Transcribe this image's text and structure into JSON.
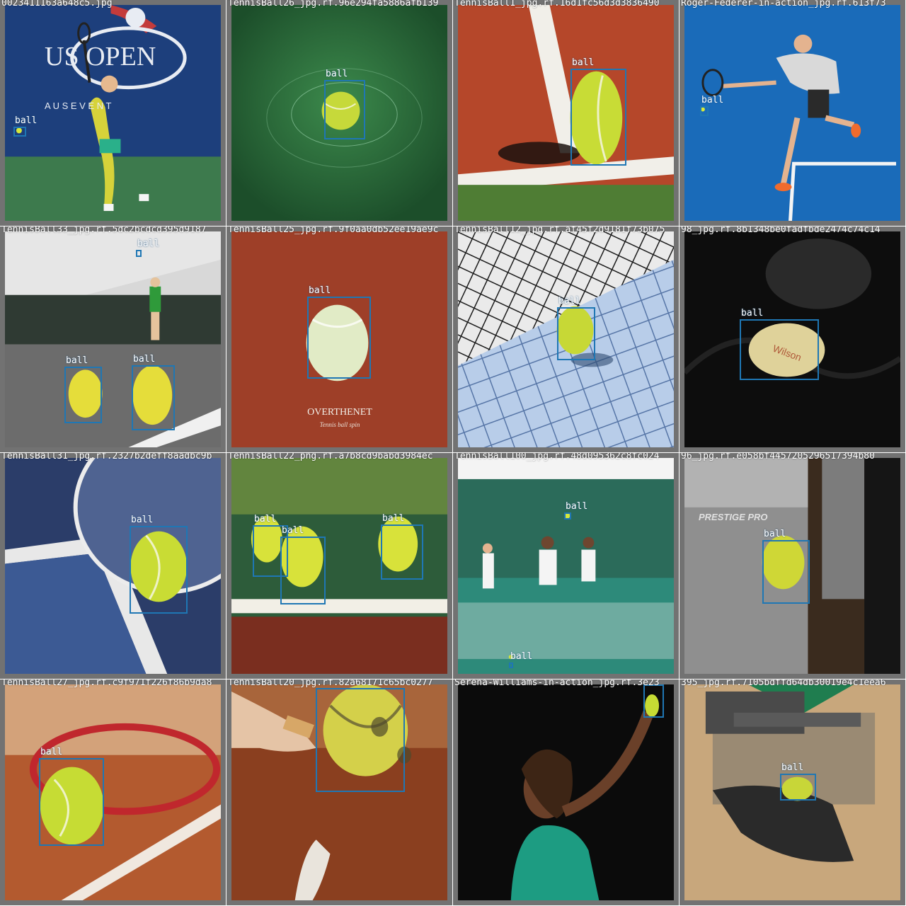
{
  "accent_colors": {
    "box": "#1f77b4",
    "tile_border": "#727272"
  },
  "tiles": [
    {
      "filename": "0023411163a648c5.jpg",
      "boxes": [
        {
          "label": "ball"
        }
      ]
    },
    {
      "filename": "TennisBall26_jpg.rf.96e294fa5886afb139",
      "boxes": [
        {
          "label": "ball"
        }
      ]
    },
    {
      "filename": "TennisBall1_jpg.rf.16d1fc56d3d3836490",
      "boxes": [
        {
          "label": "ball"
        }
      ]
    },
    {
      "filename": "Roger-Federer-in-action_jpg.rf.613f73",
      "boxes": [
        {
          "label": "ball"
        }
      ]
    },
    {
      "filename": "TennisBall33_jpg.rf.5dc2bcdcd395d9187",
      "boxes": [
        {
          "label": "ball"
        },
        {
          "label": "ball"
        },
        {
          "label": "ball"
        }
      ]
    },
    {
      "filename": "TennisBall25_jpg.rf.9f0aa0db52ee19ae9c",
      "boxes": [
        {
          "label": "ball"
        }
      ],
      "caption": "OVERTHENET",
      "subcaption": "Tennis ball spin"
    },
    {
      "filename": "TennisBall12_jpg.rf.af45f2d9181f73b075",
      "boxes": [
        {
          "label": "ball"
        }
      ]
    },
    {
      "filename": "98_jpg.rf.8b1348be0fadfbde2474c74c14",
      "boxes": [
        {
          "label": "ball"
        }
      ]
    },
    {
      "filename": "TennisBall31_jpg.rf.2327b2deff8aadbc9b",
      "boxes": [
        {
          "label": "ball"
        }
      ]
    },
    {
      "filename": "TennisBall22_png.rf.a7b8cd9babd3984ec",
      "boxes": [
        {
          "label": "ball"
        },
        {
          "label": "ball"
        },
        {
          "label": "ball"
        }
      ]
    },
    {
      "filename": "TennisBall100_jpg.rf.48d095362c8fc024",
      "boxes": [
        {
          "label": "ball"
        },
        {
          "label": "ball"
        }
      ]
    },
    {
      "filename": "96_jpg.rf.e058bf4457205296517394b80",
      "boxes": [
        {
          "label": "ball"
        }
      ],
      "caption": "PRESTIGE PRO"
    },
    {
      "filename": "TennisBall27_jpg.rf.c9f971f226f86b9da8",
      "boxes": [
        {
          "label": "ball"
        }
      ]
    },
    {
      "filename": "TennisBall20_jpg.rf.82a68171c65bc0277",
      "boxes": [
        {
          "label": "ball"
        }
      ]
    },
    {
      "filename": "Serena-Williams-in-action_jpg.rf.3e23",
      "boxes": [
        {
          "label": "ball"
        }
      ]
    },
    {
      "filename": "395_jpg.rf.7105bdffd64db30019e4c1eea6",
      "boxes": [
        {
          "label": "ball"
        }
      ]
    }
  ],
  "us_open": {
    "logo": "US OPEN",
    "banner": "A   U S   E V E N T"
  }
}
